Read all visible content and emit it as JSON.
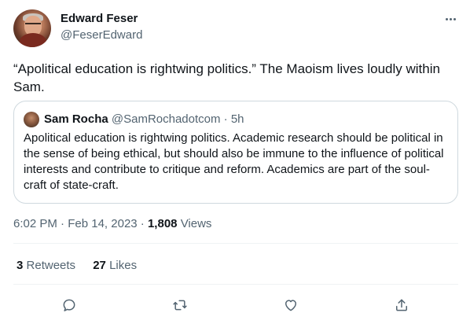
{
  "author": {
    "name": "Edward Feser",
    "handle": "@FeserEdward"
  },
  "tweet": {
    "text": "“Apolitical education is rightwing politics.” The Maoism lives loudly within Sam."
  },
  "quoted_tweet": {
    "name": "Sam Rocha",
    "handle": "@SamRochadotcom",
    "separator": "·",
    "time": "5h",
    "text": "Apolitical education is rightwing politics. Academic research should be political in the sense of being ethical, but should also be immune to the influence of political interests and contribute to critique and reform. Academics are part of the soul-craft of state-craft."
  },
  "meta": {
    "time": "6:02 PM",
    "sep1": "·",
    "date": "Feb 14, 2023",
    "sep2": "·",
    "views_count": "1,808",
    "views_label": "Views"
  },
  "stats": {
    "retweets_count": "3",
    "retweets_label": "Retweets",
    "likes_count": "27",
    "likes_label": "Likes"
  },
  "icons": {
    "more": "more-horizontal-icon",
    "reply": "reply-icon",
    "retweet": "retweet-icon",
    "like": "heart-icon",
    "share": "share-icon"
  },
  "colors": {
    "text_primary": "#0f1419",
    "text_secondary": "#536471",
    "border": "#cfd9de"
  }
}
